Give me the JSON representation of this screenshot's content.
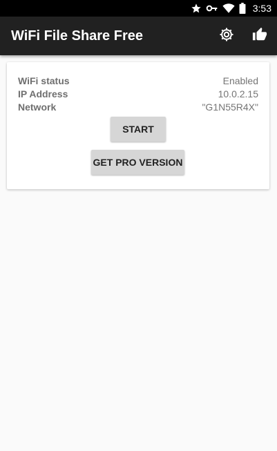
{
  "status_bar": {
    "time": "3:53",
    "icons": [
      "star-icon",
      "vpn-key-icon",
      "wifi-icon",
      "battery-icon"
    ]
  },
  "app_bar": {
    "title": "WiFi File Share Free",
    "background": "#212121",
    "actions": [
      "settings-gear-icon",
      "thumbs-up-icon"
    ]
  },
  "card": {
    "rows": [
      {
        "label": "WiFi status",
        "value": "Enabled"
      },
      {
        "label": "IP Address",
        "value": "10.0.2.15"
      },
      {
        "label": "Network",
        "value": "\"G1N55R4X\""
      }
    ],
    "start_button": "START",
    "pro_button": "GET PRO VERSION"
  },
  "colors": {
    "status_bar": "#000000",
    "app_bar": "#212121",
    "page_background": "#fafafa",
    "button": "#d6d6d6"
  }
}
